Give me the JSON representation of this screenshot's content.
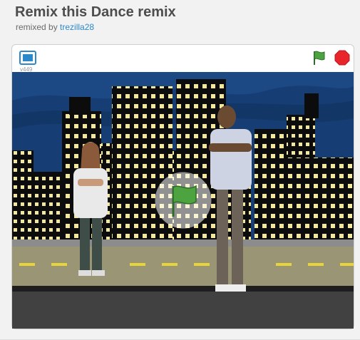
{
  "project": {
    "title": "Remix this Dance remix",
    "remixed_by_label": "remixed by",
    "author": "trezilla28"
  },
  "player": {
    "version": "v449",
    "fullscreen_icon": "fullscreen-icon",
    "green_flag_icon": "green-flag-icon",
    "stop_icon": "stop-sign-icon",
    "overlay_flag_icon": "green-flag-icon"
  },
  "colors": {
    "link": "#2c88c8",
    "green_flag": "#4ca33f",
    "stop": "#e8252b",
    "sky": "#173e74",
    "road": "#999575",
    "lane": "#e6d43a"
  }
}
